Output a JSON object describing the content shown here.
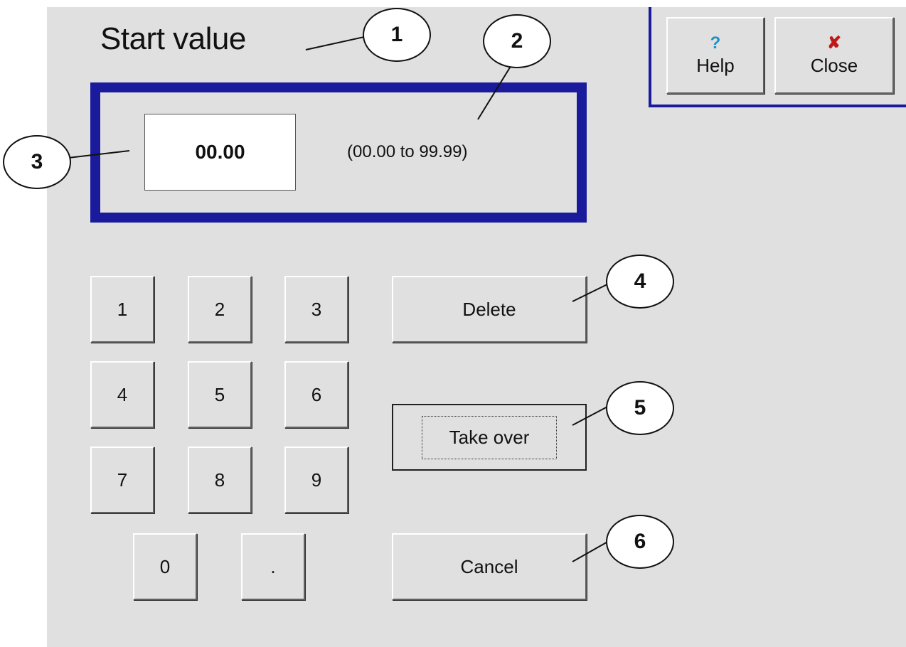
{
  "dialog": {
    "title": "Start value",
    "value": "00.00",
    "range_hint": "(00.00 to 99.99)"
  },
  "toolbar": {
    "help_label": "Help",
    "help_icon": "?",
    "close_label": "Close",
    "close_icon": "✘"
  },
  "keypad": {
    "keys": [
      "1",
      "2",
      "3",
      "4",
      "5",
      "6",
      "7",
      "8",
      "9",
      "0",
      "."
    ]
  },
  "actions": {
    "delete_label": "Delete",
    "take_over_label": "Take over",
    "cancel_label": "Cancel"
  },
  "callouts": [
    "1",
    "2",
    "3",
    "4",
    "5",
    "6"
  ],
  "colors": {
    "panel": "#e0e0e0",
    "frame": "#1a1a9c",
    "help_icon": "#1f8fc9",
    "close_icon": "#c01818"
  }
}
